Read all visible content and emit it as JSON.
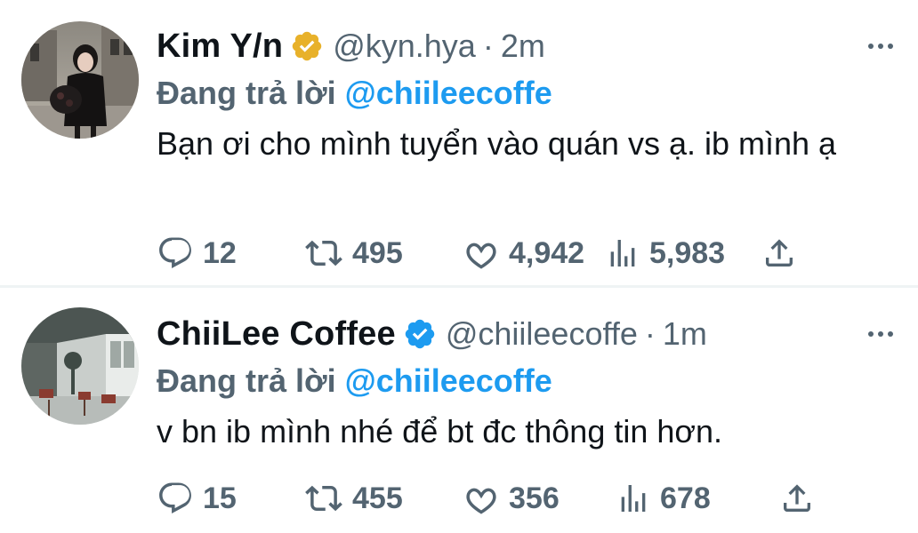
{
  "tweets": [
    {
      "display_name": "Kim Y/n",
      "verified_color": "#e8b12a",
      "handle": "@kyn.hya",
      "separator": "·",
      "time": "2m",
      "reply_prefix": "Đang trả lời",
      "reply_mention": "@chiileecoffe",
      "text": "Bạn ơi cho mình tuyển vào quán vs ạ. ib mình ạ",
      "stats": {
        "replies": "12",
        "retweets": "495",
        "likes": "4,942",
        "views": "5,983"
      }
    },
    {
      "display_name": "ChiiLee Coffee",
      "verified_color": "#1d9bf0",
      "handle": "@chiileecoffe",
      "separator": "·",
      "time": "1m",
      "reply_prefix": "Đang trả lời",
      "reply_mention": "@chiileecoffe",
      "text": "v bn ib mình nhé để bt đc thông tin hơn.",
      "stats": {
        "replies": "15",
        "retweets": "455",
        "likes": "356",
        "views": "678"
      }
    }
  ],
  "icons": {
    "more": "more-horizontal-icon",
    "reply": "reply-icon",
    "retweet": "retweet-icon",
    "like": "heart-icon",
    "views": "views-icon",
    "share": "share-icon"
  },
  "colors": {
    "muted": "#536471",
    "link": "#1d9bf0",
    "text": "#0f1419"
  }
}
